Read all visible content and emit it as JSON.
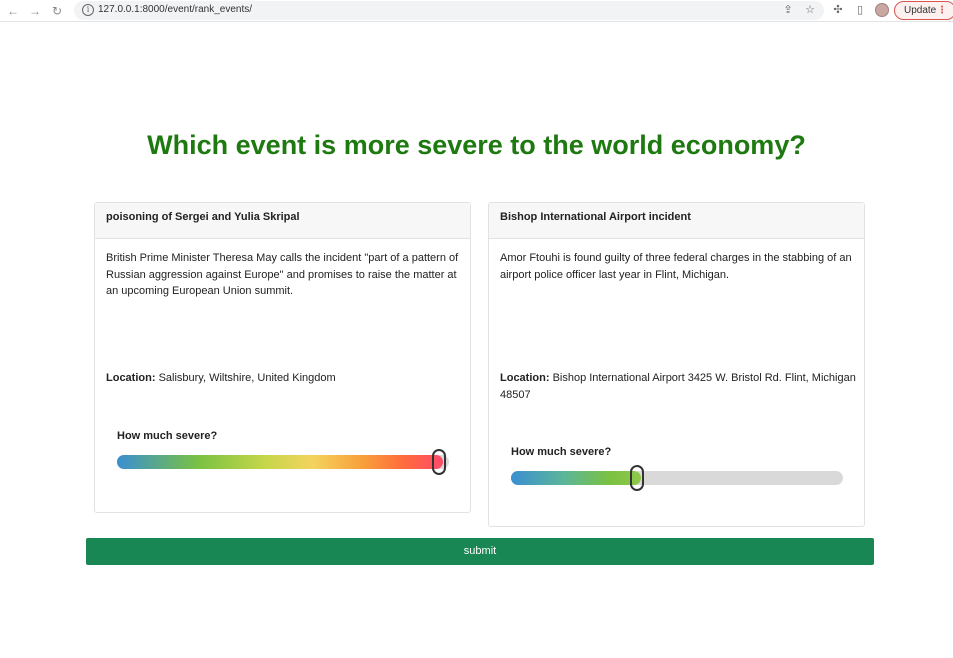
{
  "browser": {
    "url": "127.0.0.1:8000/event/rank_events/",
    "update_label": "Update"
  },
  "page": {
    "question": "Which event is more severe to the world economy?",
    "submit_label": "submit"
  },
  "events": [
    {
      "title": "poisoning of Sergei and Yulia Skripal",
      "description": "British Prime Minister Theresa May calls the incident \"part of a pattern of Russian aggression against Europe\" and promises to raise the matter at an upcoming European Union summit.",
      "location_label": "Location:",
      "location": "Salisbury, Wiltshire, United Kingdom",
      "severity_label": "How much severe?",
      "severity_fraction": 0.97
    },
    {
      "title": "Bishop International Airport incident",
      "description": "Amor Ftouhi is found guilty of three federal charges in the stabbing of an airport police officer last year in Flint, Michigan.",
      "location_label": "Location:",
      "location": "Bishop International Airport 3425 W. Bristol Rd. Flint, Michigan 48507",
      "severity_label": "How much severe?",
      "severity_fraction": 0.38
    }
  ],
  "colors": {
    "heading": "#1e7a10",
    "submit_bg": "#198754",
    "update_border": "#d9534f"
  }
}
